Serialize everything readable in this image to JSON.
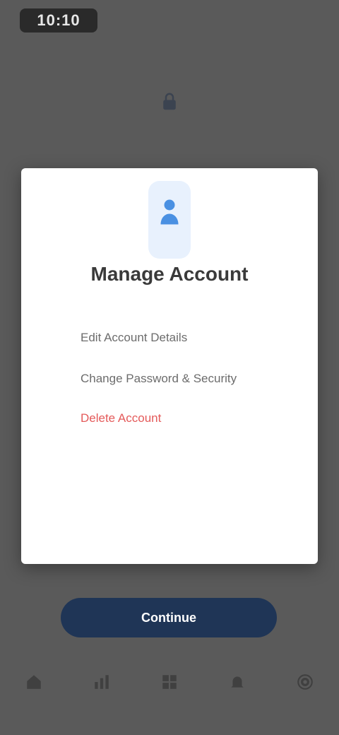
{
  "status_bar": {
    "time": "10:10"
  },
  "header": {
    "icon": "lock-icon"
  },
  "modal": {
    "icon": "user-icon",
    "title": "Manage Account",
    "items": [
      {
        "label": "Edit Account Details"
      },
      {
        "label": "Change Password & Security"
      }
    ],
    "danger_item": {
      "label": "Delete Account"
    }
  },
  "primary_button": {
    "label": "Continue"
  },
  "bottom_nav": {
    "items": [
      "home-icon",
      "chart-icon",
      "grid-icon",
      "bell-icon",
      "settings-icon"
    ]
  },
  "colors": {
    "accent": "#1f3556",
    "icon_blue": "#4a90e2",
    "danger": "#e45a5a"
  }
}
